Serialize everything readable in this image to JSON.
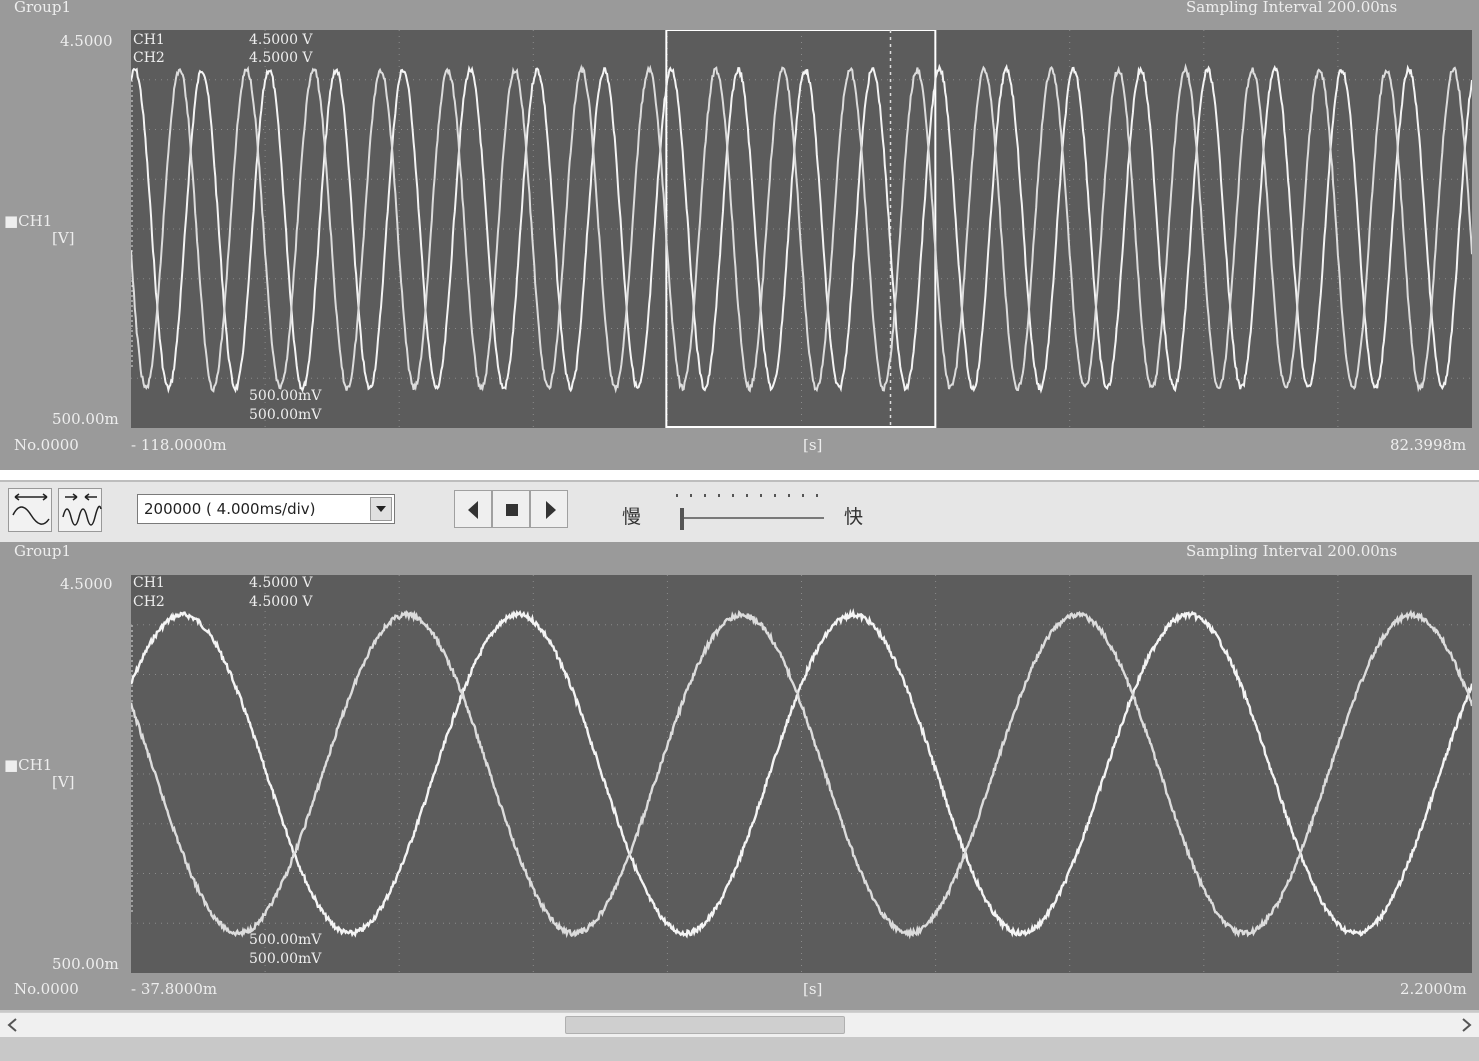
{
  "top_window": {
    "group_label": "Group1",
    "sampling_text": "Sampling Interval  200.00ns",
    "y_max": "4.5000",
    "y_min": "500.00m",
    "channel_label": "■CH1",
    "unit_label": "[V]",
    "ch1_name": "CH1",
    "ch2_name": "CH2",
    "ch1_top_value": "4.5000 V",
    "ch2_top_value": "4.5000 V",
    "ch1_div_value": "500.00mV",
    "ch2_div_value": "500.00mV",
    "record_no": "No.0000",
    "x_start": "- 118.0000m",
    "x_unit": "[s]",
    "x_end": "82.3998m"
  },
  "toolbar": {
    "zoom_out_icon": "expand-horizontal-icon",
    "zoom_in_icon": "compress-horizontal-icon",
    "sample_select_value": "200000  ( 4.000ms/div)",
    "prev_icon": "triangle-left-icon",
    "stop_icon": "stop-square-icon",
    "next_icon": "triangle-right-icon",
    "slow_label": "慢",
    "fast_label": "快",
    "speed_level": 0
  },
  "bottom_window": {
    "group_label": "Group1",
    "sampling_text": "Sampling Interval  200.00ns",
    "y_max": "4.5000",
    "y_min": "500.00m",
    "channel_label": "■CH1",
    "unit_label": "[V]",
    "ch1_name": "CH1",
    "ch2_name": "CH2",
    "ch1_top_value": "4.5000 V",
    "ch2_top_value": "4.5000 V",
    "ch1_div_value": "500.00mV",
    "ch2_div_value": "500.00mV",
    "record_no": "No.0000",
    "x_start": "- 37.8000m",
    "x_unit": "[s]",
    "x_end": "2.2000m"
  },
  "chart_data": [
    {
      "type": "line",
      "x_unit": "s",
      "xlim": [
        -0.118,
        0.0823998
      ],
      "ylim": [
        0.5,
        4.5
      ],
      "series": [
        {
          "name": "CH1",
          "form": "sine",
          "amplitude_v": 1.6,
          "offset_v": 2.5,
          "cycles_in_view": 20
        },
        {
          "name": "CH2",
          "form": "sine",
          "amplitude_v": 1.6,
          "offset_v": 2.5,
          "cycles_in_view": 20,
          "phase_shift_deg": 120
        }
      ],
      "zoom_window_x": [
        -0.038,
        0.0022
      ],
      "cursor_x": -0.0045,
      "grid": true
    },
    {
      "type": "line",
      "x_unit": "s",
      "xlim": [
        -0.0378,
        0.0022
      ],
      "ylim": [
        0.5,
        4.5
      ],
      "series": [
        {
          "name": "CH1",
          "form": "sine",
          "amplitude_v": 1.6,
          "offset_v": 2.5,
          "cycles_in_view": 4
        },
        {
          "name": "CH2",
          "form": "sine",
          "amplitude_v": 1.6,
          "offset_v": 2.5,
          "cycles_in_view": 4,
          "phase_shift_deg": 120
        }
      ],
      "grid": true
    }
  ],
  "scrollbar": {
    "left_icon": "chevron-left-icon",
    "right_icon": "chevron-right-icon",
    "position": 0.47
  }
}
